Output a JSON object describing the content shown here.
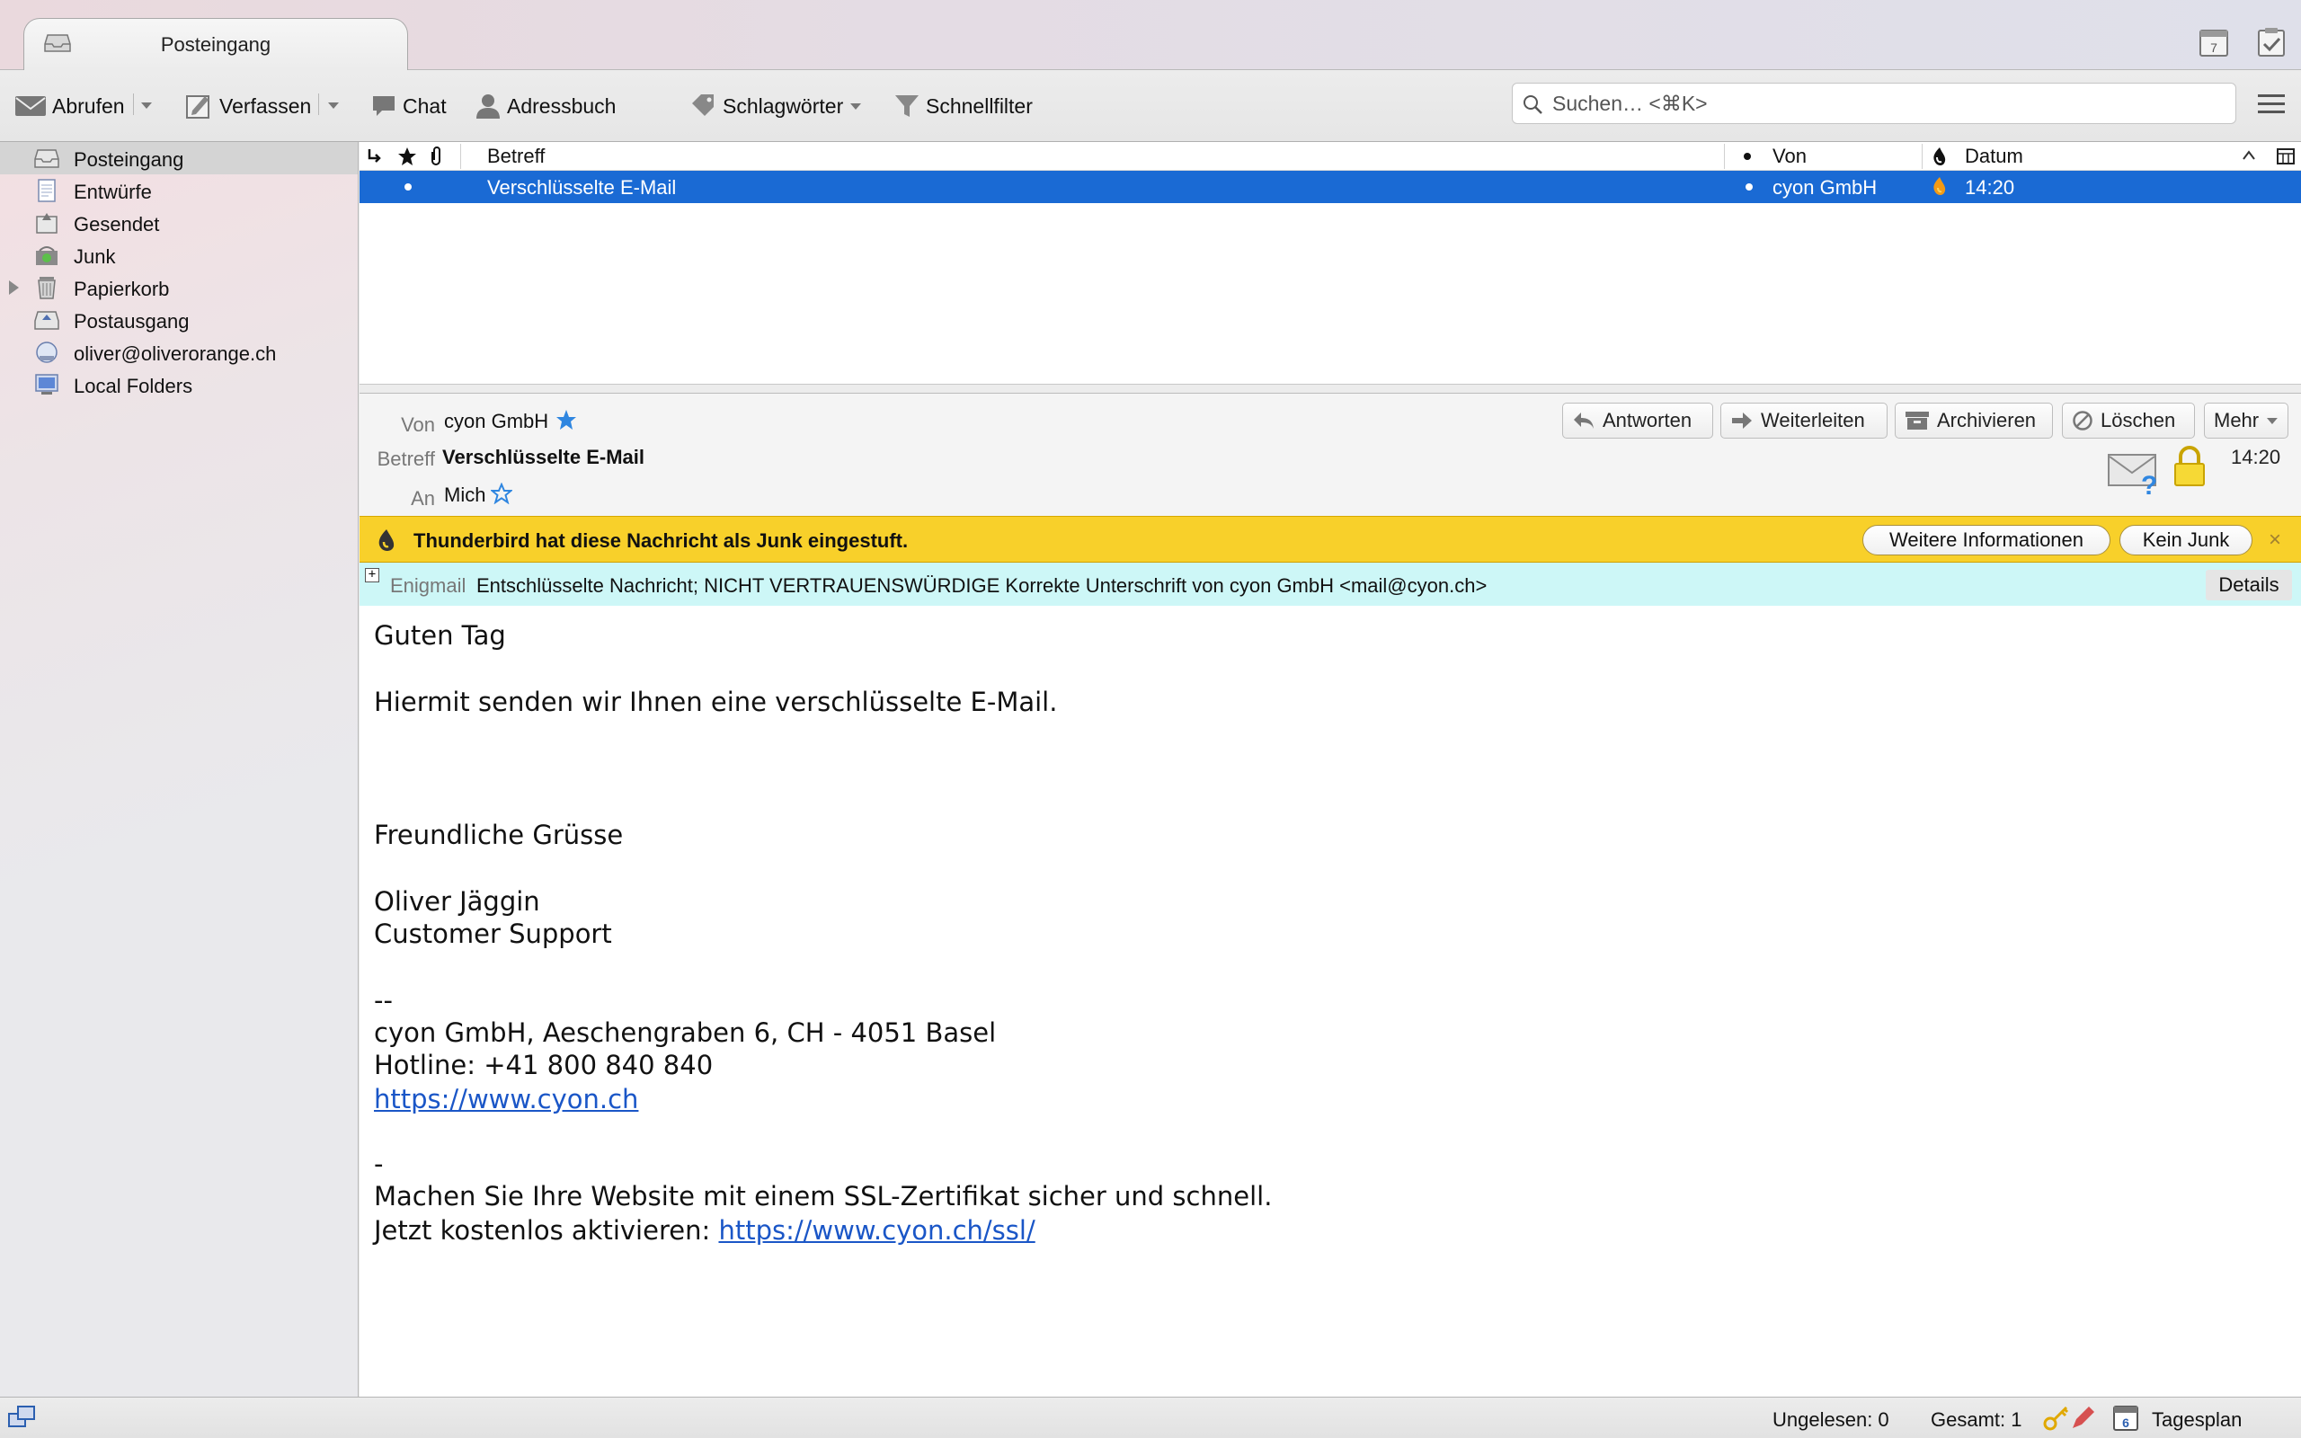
{
  "tab": {
    "title": "Posteingang"
  },
  "toolbar": {
    "get_mail": "Abrufen",
    "write": "Verfassen",
    "chat": "Chat",
    "address_book": "Adressbuch",
    "tags": "Schlagwörter",
    "quick_filter": "Schnellfilter",
    "search_placeholder": "Suchen… <⌘K>"
  },
  "folders": [
    {
      "label": "Posteingang",
      "icon": "inbox-icon",
      "selected": true
    },
    {
      "label": "Entwürfe",
      "icon": "drafts-icon"
    },
    {
      "label": "Gesendet",
      "icon": "sent-icon"
    },
    {
      "label": "Junk",
      "icon": "junk-icon"
    },
    {
      "label": "Papierkorb",
      "icon": "trash-icon",
      "expandable": true
    },
    {
      "label": "Postausgang",
      "icon": "outbox-icon"
    },
    {
      "label": "oliver@oliverorange.ch",
      "icon": "account-icon"
    },
    {
      "label": "Local Folders",
      "icon": "local-folders-icon"
    }
  ],
  "thread_columns": {
    "subject": "Betreff",
    "from": "Von",
    "date": "Datum"
  },
  "messages": [
    {
      "subject": "Verschlüsselte E-Mail",
      "from": "cyon GmbH",
      "date": "14:20",
      "junk": true,
      "selected": true
    }
  ],
  "header": {
    "from_label": "Von",
    "from_value": "cyon GmbH",
    "subject_label": "Betreff",
    "subject_value": "Verschlüsselte E-Mail",
    "to_label": "An",
    "to_value": "Mich",
    "time": "14:20",
    "actions": {
      "reply": "Antworten",
      "forward": "Weiterleiten",
      "archive": "Archivieren",
      "delete": "Löschen",
      "more": "Mehr"
    }
  },
  "junk_bar": {
    "text": "Thunderbird hat diese Nachricht als Junk eingestuft.",
    "more_info": "Weitere Informationen",
    "not_junk": "Kein Junk",
    "close": "×"
  },
  "enigmail": {
    "label": "Enigmail",
    "text": "Entschlüsselte Nachricht; NICHT VERTRAUENSWÜRDIGE Korrekte Unterschrift von cyon GmbH <mail@cyon.ch>",
    "details": "Details"
  },
  "body": {
    "greeting": "Guten Tag",
    "line1": "Hiermit senden wir Ihnen eine verschlüsselte E-Mail.",
    "closing": "Freundliche Grüsse",
    "name": "Oliver Jäggin",
    "role": "Customer Support",
    "sig_sep": "--",
    "address": "cyon GmbH, Aeschengraben 6, CH - 4051 Basel",
    "hotline": "Hotline: +41 800 840 840",
    "website": "https://www.cyon.ch",
    "sep2": "-",
    "promo": "Machen Sie Ihre Website mit einem SSL-Zertifikat sicher und schnell.",
    "promo2_prefix": "Jetzt kostenlos aktivieren: ",
    "promo2_link": "https://www.cyon.ch/ssl/"
  },
  "status": {
    "unread": "Ungelesen: 0",
    "total": "Gesamt: 1",
    "day_plan": "Tagesplan",
    "calendar_day": "6"
  },
  "calendar_icon_day": "7",
  "colors": {
    "selection": "#1a6ad4",
    "junk_bar": "#f8d02a",
    "enigmail_bar": "#cdf7f7",
    "link": "#1a56c7"
  }
}
